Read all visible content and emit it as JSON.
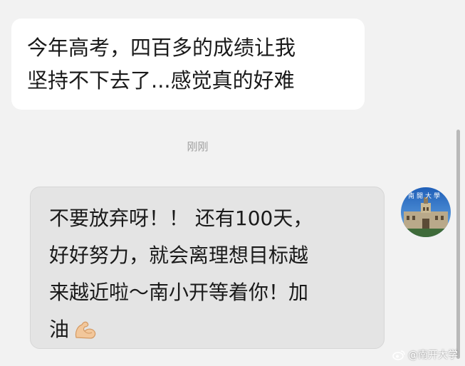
{
  "messages": {
    "incoming_text": "今年高考，四百多的成绩让我\n坚持不下去了...感觉真的好难",
    "timestamp": "刚刚",
    "outgoing_text": "不要放弃呀！！ 还有100天，\n好好努力，就会离理想目标越\n来越近啦～南小开等着你！加\n油",
    "outgoing_emoji": "flexed-biceps-icon"
  },
  "avatar": {
    "logo_text": "南開大學"
  },
  "watermark": {
    "icon": "weibo-icon",
    "text": "@南开大学"
  },
  "colors": {
    "background": "#f2f2f2",
    "incoming_bubble": "#ffffff",
    "outgoing_bubble": "#e4e4e4",
    "timestamp": "#a0a0a0"
  }
}
